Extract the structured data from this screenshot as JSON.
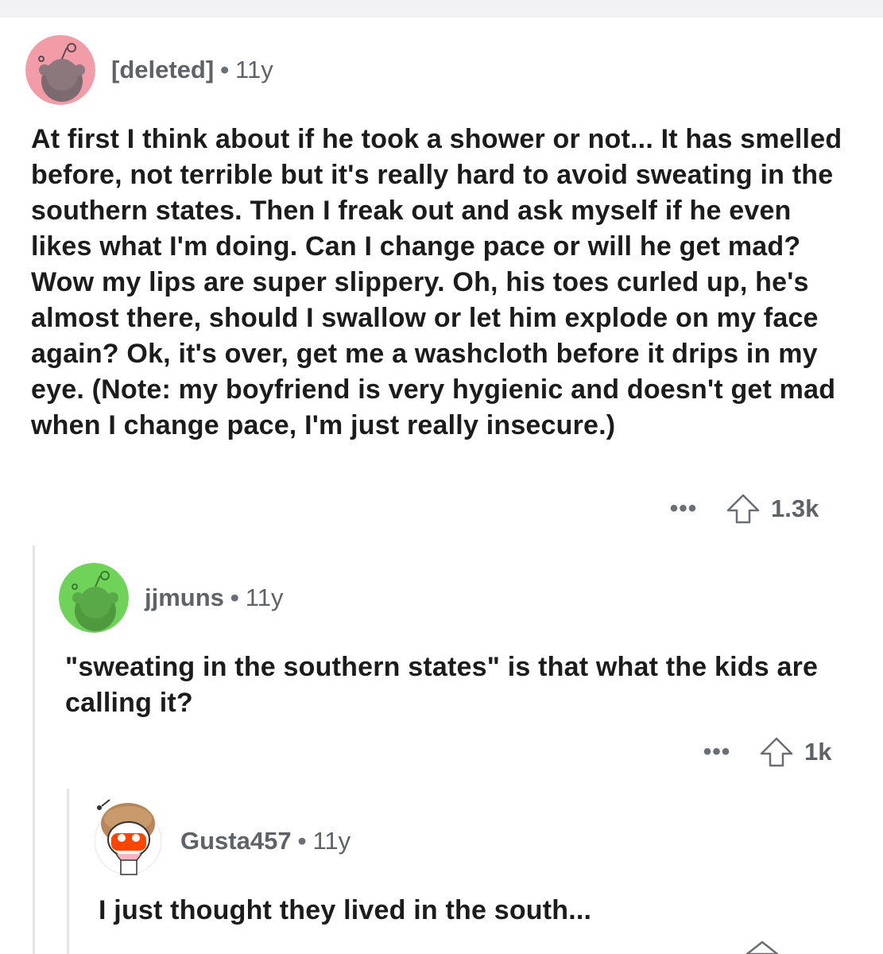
{
  "comments": [
    {
      "author": "[deleted]",
      "age": "11y",
      "text": "At first I think about if he took a shower or not... It has smelled before, not terrible but it's really hard to avoid sweating in the southern states. Then I freak out and ask myself if he even likes what I'm doing. Can I change pace or will he get mad? Wow my lips are super slippery. Oh, his toes curled up, he's almost there, should I swallow or let him explode on my face again? Ok, it's over, get me a washcloth before it drips in my eye. (Note: my boyfriend is very hygienic and doesn't get mad when I change pace, I'm just really insecure.)",
      "more": "•••",
      "score": "1.3k",
      "avatar_color": "#f29ca7"
    },
    {
      "author": "jjmuns",
      "age": "11y",
      "text": "\"sweating in the southern states\" is that what the kids are calling it?",
      "more": "•••",
      "score": "1k",
      "avatar_color": "#6fd35a"
    },
    {
      "author": "Gusta457",
      "age": "11y",
      "text": "I just thought they lived in the south...",
      "avatar_color": "#ffffff"
    }
  ],
  "separator": "•"
}
